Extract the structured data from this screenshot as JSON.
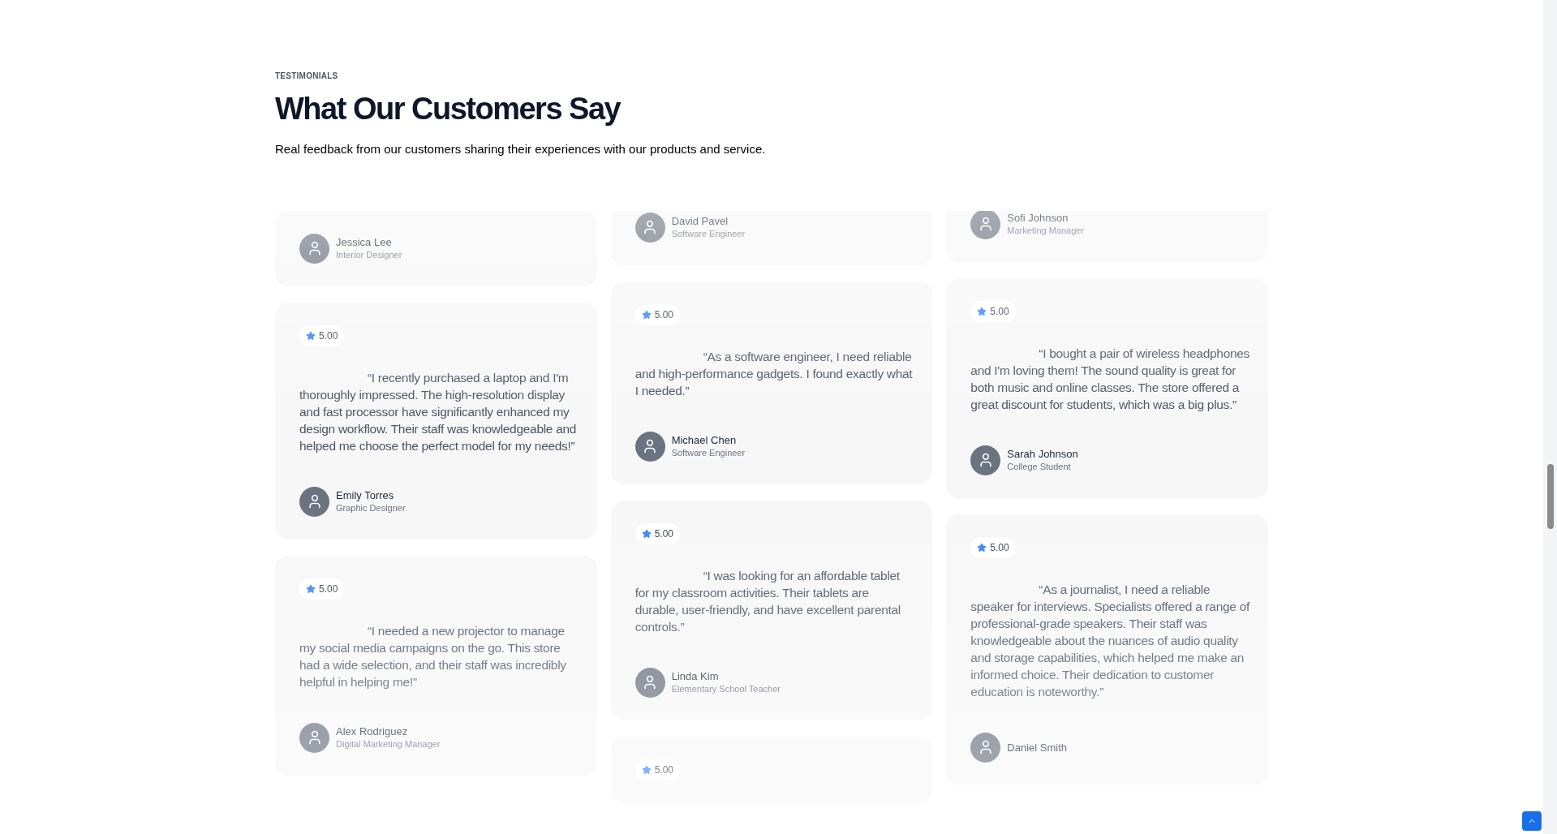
{
  "eyebrow": "TESTIMONIALS",
  "title": "What Our Customers Say",
  "subtitle": "Real feedback from our customers sharing their experiences with our products and service.",
  "columns": [
    {
      "cards": [
        {
          "name": "Jessica Lee",
          "role": "Interior Designer"
        },
        {
          "rating": "5.00",
          "quote": "“I recently purchased a laptop and I'm thoroughly impressed. The high-resolution display and fast processor have significantly enhanced my design workflow. Their staff was knowledgeable and helped me choose the perfect model for my needs!”",
          "name": "Emily Torres",
          "role": "Graphic Designer"
        },
        {
          "rating": "5.00",
          "quote": "“I needed a new projector to manage my social media campaigns on the go. This store had a wide selection, and their staff was incredibly helpful in helping me!”",
          "name": "Alex Rodriguez",
          "role": "Digital Marketing Manager"
        }
      ]
    },
    {
      "cards": [
        {
          "name": "David Pavel",
          "role": "Software Engineer"
        },
        {
          "rating": "5.00",
          "quote": "“As a software engineer, I need reliable and high-performance gadgets. I found exactly what I needed.”",
          "name": "Michael Chen",
          "role": "Software Engineer"
        },
        {
          "rating": "5.00",
          "quote": "“I was looking for an affordable tablet for my classroom activities. Their tablets are durable, user-friendly, and have excellent parental controls.”",
          "name": "Linda Kim",
          "role": "Elementary School Teacher"
        },
        {
          "rating": "5.00"
        }
      ]
    },
    {
      "cards": [
        {
          "name": "Sofi Johnson",
          "role": "Marketing Manager"
        },
        {
          "rating": "5.00",
          "quote": "“I bought a pair of wireless headphones and I'm loving them! The sound quality is great for both music and online classes. The store offered a great discount for students, which was a big plus.”",
          "name": "Sarah Johnson",
          "role": "College Student"
        },
        {
          "rating": "5.00",
          "quote": "“As a journalist, I need a reliable speaker for interviews. Specialists offered a range of professional-grade speakers. Their staff was knowledgeable about the nuances of audio quality and storage capabilities, which helped me make an informed choice. Their dedication to customer education is noteworthy.”",
          "name": "Daniel Smith"
        }
      ]
    }
  ]
}
